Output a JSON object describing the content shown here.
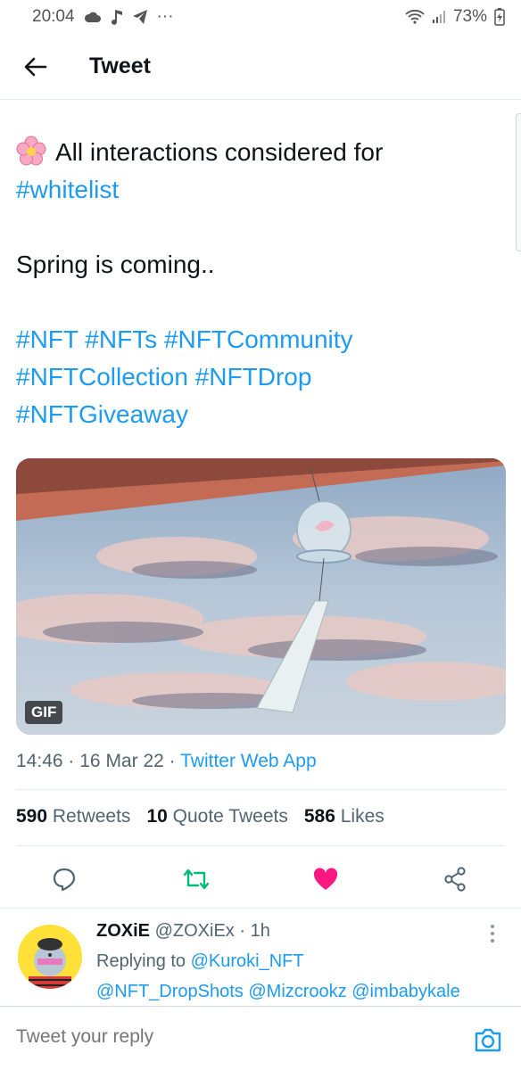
{
  "status_bar": {
    "time": "20:04",
    "battery": "73%",
    "overflow": "···"
  },
  "header": {
    "title": "Tweet"
  },
  "tweet": {
    "line1_text": "All interactions considered for",
    "line1_hashtag": "#whitelist",
    "line2": "Spring is coming..",
    "hashtags": [
      "#NFT",
      "#NFTs",
      "#NFTCommunity",
      "#NFTCollection",
      "#NFTDrop",
      "#NFTGiveaway"
    ],
    "media_badge": "GIF",
    "time": "14:46",
    "date": "16 Mar 22",
    "separator": "·",
    "source": "Twitter Web App",
    "stats": {
      "retweets_count": "590",
      "retweets_label": "Retweets",
      "quotes_count": "10",
      "quotes_label": "Quote Tweets",
      "likes_count": "586",
      "likes_label": "Likes"
    },
    "liked": true,
    "colors": {
      "accent": "#1d9bf0",
      "retweet": "#00ba7c",
      "like": "#f91880"
    }
  },
  "reply": {
    "name": "ZOXiE",
    "handle": "@ZOXiEx",
    "age": "1h",
    "replying_prefix": "Replying to",
    "replying_to_1": "@Kuroki_NFT",
    "replying_to_2": "@NFT_DropShots",
    "replying_to_3": "@Mizcrookz",
    "replying_to_4": "@imbabykale"
  },
  "composer": {
    "placeholder": "Tweet your reply"
  }
}
